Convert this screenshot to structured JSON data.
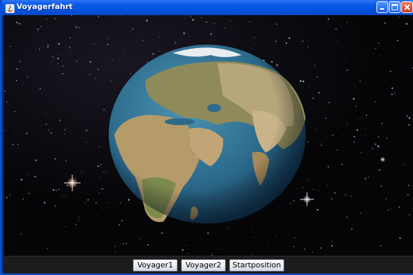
{
  "window": {
    "title": "Voyagerfahrt"
  },
  "controls": {
    "minimize_icon": "minimize-icon",
    "maximize_icon": "maximize-icon",
    "close_icon": "close-icon"
  },
  "buttons": [
    {
      "label": "Voyager1"
    },
    {
      "label": "Voyager2"
    },
    {
      "label": "Startposition"
    }
  ],
  "colors": {
    "titlebar": "#0a5be8",
    "close_button": "#c7391b",
    "space": "#050507",
    "ocean": "#2f6f8f"
  }
}
